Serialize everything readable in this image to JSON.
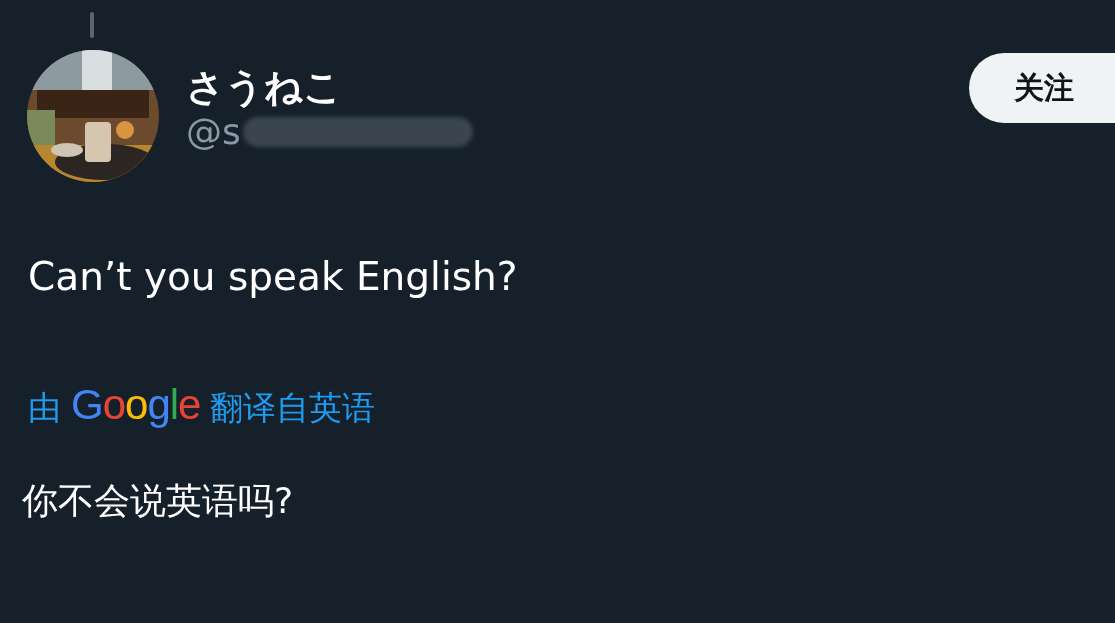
{
  "author": {
    "name": "さうねこ",
    "handle": "@s"
  },
  "follow_button": {
    "label": "关注"
  },
  "tweet": {
    "text": "Can’t you speak English?"
  },
  "translation": {
    "prefix": "由",
    "brand": "Google",
    "suffix": "翻译自英语",
    "text": "你不会说英语吗?"
  }
}
